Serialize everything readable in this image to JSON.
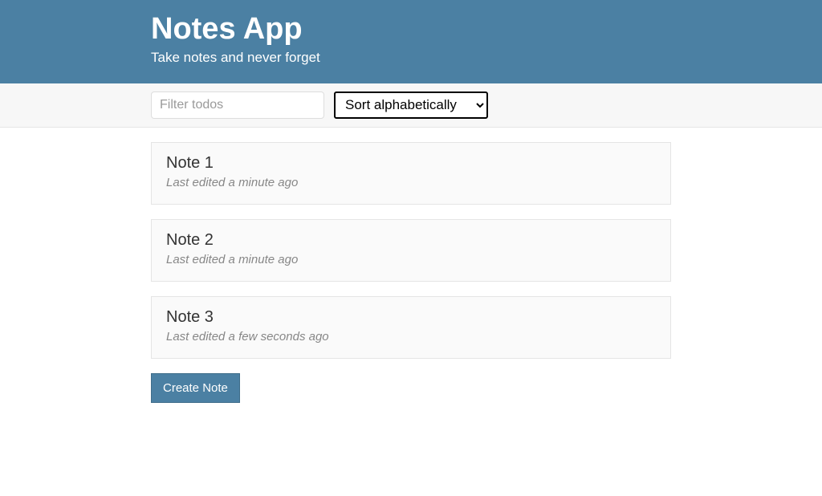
{
  "header": {
    "title": "Notes App",
    "subtitle": "Take notes and never forget"
  },
  "filter": {
    "placeholder": "Filter todos",
    "value": ""
  },
  "sort": {
    "selected": "Sort alphabetically",
    "options": [
      "Sort alphabetically"
    ]
  },
  "notes": [
    {
      "title": "Note 1",
      "meta": "Last edited a minute ago"
    },
    {
      "title": "Note 2",
      "meta": "Last edited a minute ago"
    },
    {
      "title": "Note 3",
      "meta": "Last edited a few seconds ago"
    }
  ],
  "buttons": {
    "create": "Create Note"
  }
}
